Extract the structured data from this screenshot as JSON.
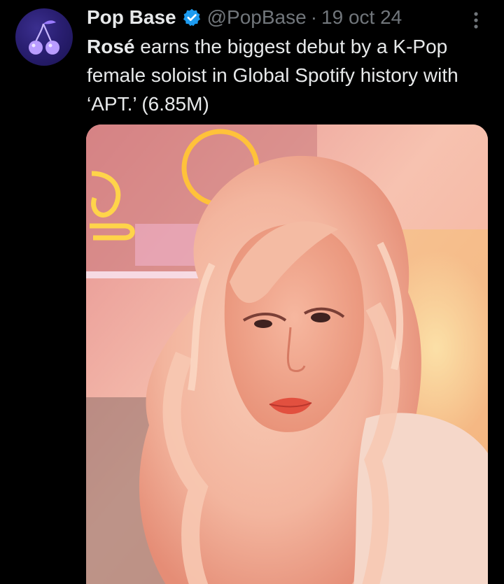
{
  "tweet": {
    "author": {
      "display_name": "Pop Base",
      "handle": "@PopBase",
      "avatar_icon": "cherry-icon",
      "verified": true,
      "verified_color": "#1d9bf0"
    },
    "separator": "·",
    "date": "19 oct 24",
    "text_bold": "Rosé",
    "text_rest": " earns the biggest debut by a K-Pop female soloist in Global Spotify history with ‘APT.’ (6.85M)",
    "media": {
      "type": "photo",
      "icon": "photo-portrait"
    }
  },
  "colors": {
    "background": "#000000",
    "primary_text": "#e7e9ea",
    "secondary_text": "#71767b",
    "accent": "#1d9bf0"
  }
}
